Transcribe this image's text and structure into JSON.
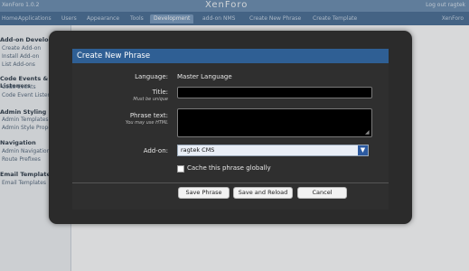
{
  "topbar": {
    "version": "XenForo 1.0.2",
    "brand": "XenForo",
    "logout": "Log out ragtek"
  },
  "nav": {
    "tabs": [
      "Home",
      "Applications",
      "Users",
      "Appearance",
      "Tools",
      "Development",
      "add-on NMS",
      "Create New Phrase",
      "Create Template"
    ],
    "active_index": 5,
    "user": "XenForo"
  },
  "sidebar": {
    "sections": [
      {
        "title": "Add-on Development",
        "items": [
          "Create Add-on",
          "Install Add-on",
          "List Add-ons"
        ]
      },
      {
        "title": "Code Events & Listeners",
        "items": [
          "Code Events",
          "Code Event Listeners"
        ]
      },
      {
        "title": "Admin Styling",
        "items": [
          "Admin Templates",
          "Admin Style Properties"
        ]
      },
      {
        "title": "Navigation",
        "items": [
          "Admin Navigation",
          "Route Prefixes"
        ]
      },
      {
        "title": "Email Templates",
        "items": [
          "Email Templates"
        ]
      }
    ]
  },
  "modal": {
    "title": "Create New Phrase",
    "language_label": "Language:",
    "language_value": "Master Language",
    "title_label": "Title:",
    "title_hint": "Must be unique",
    "title_value": "",
    "phrase_label": "Phrase text:",
    "phrase_hint": "You may use HTML",
    "phrase_value": "",
    "addon_label": "Add-on:",
    "addon_selected": "ragtek CMS",
    "cache_label": "Cache this phrase globally",
    "cache_checked": false,
    "buttons": {
      "save": "Save Phrase",
      "save_reload": "Save and Reload",
      "cancel": "Cancel"
    }
  },
  "colors": {
    "title_bar": "#2f5f94",
    "modal_bg": "#2f2f2f",
    "nav_bg": "#4b6f96"
  }
}
